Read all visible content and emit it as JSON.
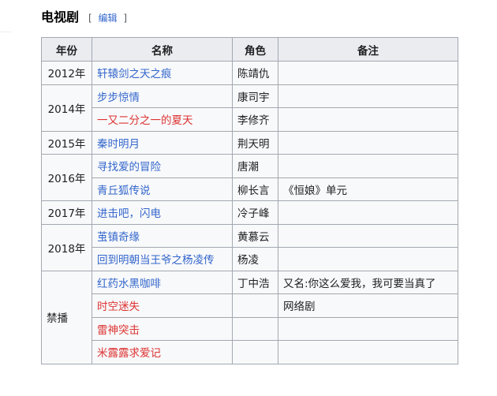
{
  "section": {
    "title": "电视剧",
    "edit_open": "[",
    "edit_label": "编辑",
    "edit_close": "]"
  },
  "table": {
    "headers": [
      "年份",
      "名称",
      "角色",
      "备注"
    ],
    "rows": [
      {
        "year": "2012年",
        "title": "轩辕剑之天之痕",
        "role": "陈靖仇",
        "note": "",
        "link": "blue"
      },
      {
        "year": "2014年",
        "title": "步步惊情",
        "role": "康司宇",
        "note": "",
        "link": "blue"
      },
      {
        "year": "",
        "title": "一又二分之一的夏天",
        "role": "李修齐",
        "note": "",
        "link": "red"
      },
      {
        "year": "2015年",
        "title": "秦时明月",
        "role": "荆天明",
        "note": "",
        "link": "blue"
      },
      {
        "year": "2016年",
        "title": "寻找爱的冒险",
        "role": "唐潮",
        "note": "",
        "link": "blue"
      },
      {
        "year": "",
        "title": "青丘狐传说",
        "role": "柳长言",
        "note": "《恒娘》单元",
        "link": "blue"
      },
      {
        "year": "2017年",
        "title": "进击吧，闪电",
        "role": "冷子峰",
        "note": "",
        "link": "blue"
      },
      {
        "year": "2018年",
        "title": "茧镇奇缘",
        "role": "黄慕云",
        "note": "",
        "link": "blue"
      },
      {
        "year": "",
        "title": "回到明朝当王爷之杨凌传",
        "role": "杨凌",
        "note": "",
        "link": "blue"
      },
      {
        "year": "禁播",
        "title": "红药水黑咖啡",
        "role": "丁中浩",
        "note": "又名:你这么爱我，我可要当真了",
        "link": "blue"
      },
      {
        "year": "",
        "title": "时空迷失",
        "role": "",
        "note": "网络剧",
        "link": "red"
      },
      {
        "year": "",
        "title": "雷神突击",
        "role": "",
        "note": "",
        "link": "red"
      },
      {
        "year": "",
        "title": "米露露求爱记",
        "role": "",
        "note": "",
        "link": "red"
      }
    ]
  },
  "colors": {
    "link": "#3366cc",
    "redlink": "#dd3333",
    "border": "#a2a9b1",
    "header_bg": "#eaecf0",
    "cell_bg": "#f8f9fa"
  }
}
